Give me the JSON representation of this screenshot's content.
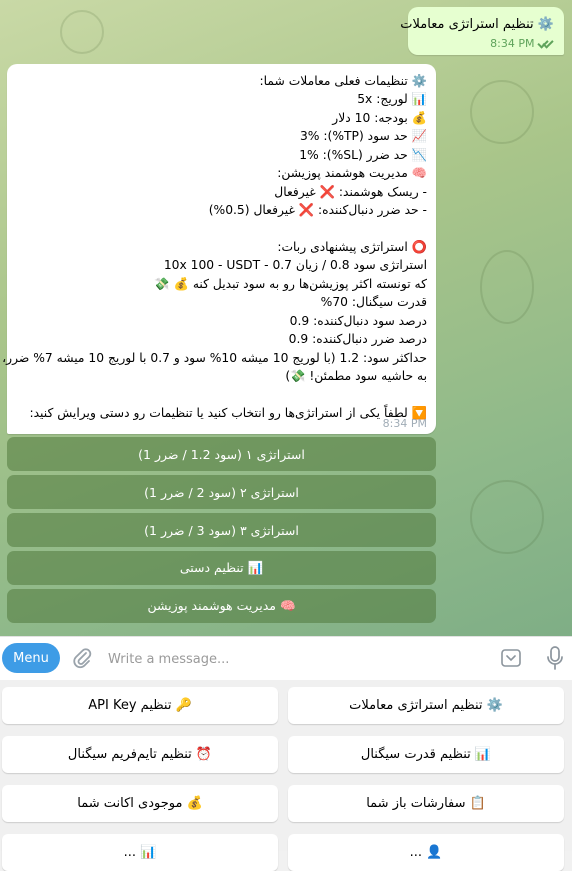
{
  "outgoing": {
    "icon": "gear-icon",
    "text": "⚙️ تنظیم استراتژی معاملات",
    "time": "8:34 PM"
  },
  "incoming": {
    "lines": [
      "⚙️ تنظیمات فعلی معاملات شما:",
      "📊 لوریج: 5x",
      "💰 بودجه: 10 دلار",
      "📈 حد سود (TP%): 3%",
      "📉 حد ضرر (SL%): 1%",
      "🧠 مدیریت هوشمند پوزیشن:",
      "- ریسک هوشمند: ❌ غیرفعال",
      "- حد ضرر دنبال‌کننده: ❌ غیرفعال (0.5%)",
      "",
      "⭕ استراتژی پیشنهادی ربات:",
      "استراتژی سود 0.8 / زیان 0.7 - 10x 100 - USDT",
      "که تونسته اکثر پوزیشن‌ها رو به سود تبدیل کنه 💰 💸",
      "قدرت سیگنال: 70%",
      "درصد سود دنبال‌کننده: 0.9",
      "درصد ضرر دنبال‌کننده: 0.9",
      "حداکثر سود: 1.2 (با لوریج 10 میشه 10% سود و 0.7 با لوریج 10 میشه 7% ضرر،",
      "به حاشیه سود مطمئن! 💸)",
      "",
      "🔽 لطفاً یکی از استراتژی‌ها رو انتخاب کنید یا تنظیمات رو دستی ویرایش کنید:"
    ],
    "time": "8:34 PM"
  },
  "inline_keyboard": [
    {
      "label": "استراتژی ۱ (سود 1.2 / ضرر 1)"
    },
    {
      "label": "استراتژی ۲ (سود 2 / ضرر 1)"
    },
    {
      "label": "استراتژی ۳ (سود 3 / ضرر 1)"
    },
    {
      "label": "📊 تنظیم دستی"
    },
    {
      "label": "🧠 مدیریت هوشمند پوزیشن"
    }
  ],
  "composer": {
    "menu_label": "Menu",
    "placeholder": "Write a message..."
  },
  "reply_keyboard": [
    {
      "label": "⚙️ تنظیم استراتژی معاملات"
    },
    {
      "label": "🔑 تنظیم API Key"
    },
    {
      "label": "📊 تنظیم قدرت سیگنال"
    },
    {
      "label": "⏰ تنظیم تایم‌فریم سیگنال"
    },
    {
      "label": "📋 سفارشات باز شما"
    },
    {
      "label": "💰 موجودی اکانت شما"
    },
    {
      "label": "👤 ..."
    },
    {
      "label": "📊 ..."
    }
  ],
  "colors": {
    "menu_button": "#3e9ce6",
    "outgoing_bubble": "#e6ffd0",
    "read_ticks": "#5fa35b"
  }
}
